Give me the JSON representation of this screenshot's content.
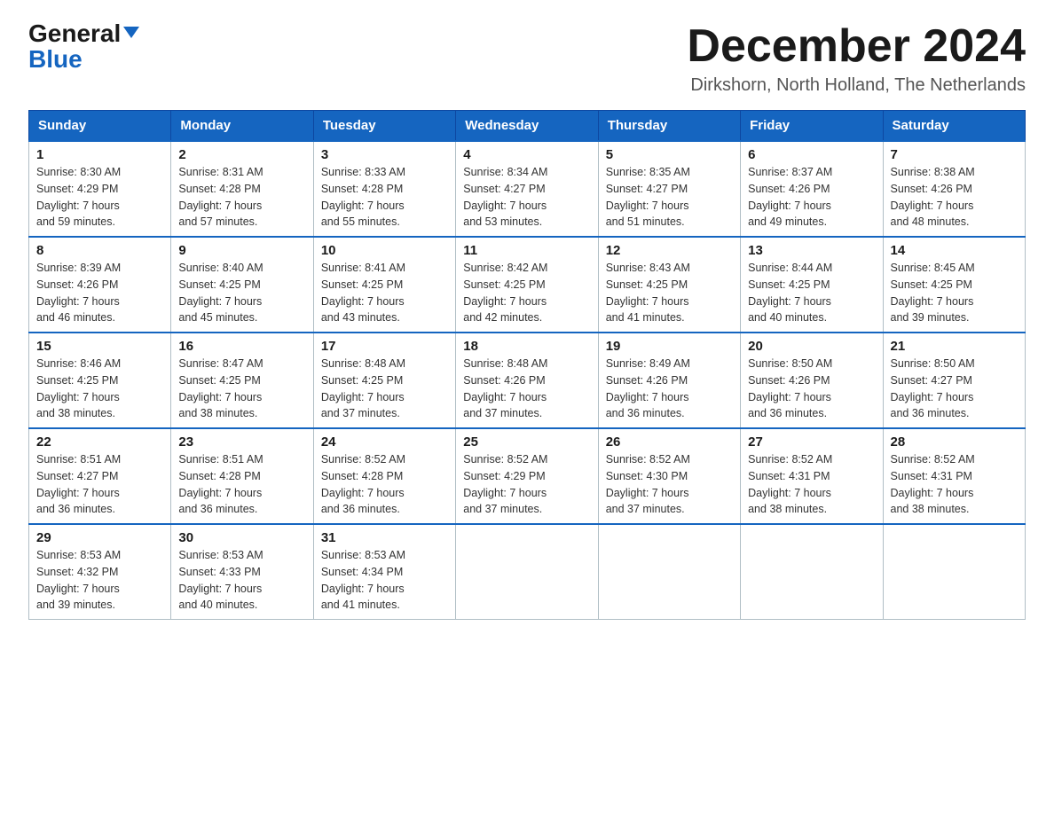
{
  "logo": {
    "general": "General",
    "triangle": "▲",
    "blue": "Blue"
  },
  "header": {
    "month_year": "December 2024",
    "location": "Dirkshorn, North Holland, The Netherlands"
  },
  "days_of_week": [
    "Sunday",
    "Monday",
    "Tuesday",
    "Wednesday",
    "Thursday",
    "Friday",
    "Saturday"
  ],
  "weeks": [
    [
      {
        "day": "1",
        "sunrise": "8:30 AM",
        "sunset": "4:29 PM",
        "daylight": "7 hours and 59 minutes."
      },
      {
        "day": "2",
        "sunrise": "8:31 AM",
        "sunset": "4:28 PM",
        "daylight": "7 hours and 57 minutes."
      },
      {
        "day": "3",
        "sunrise": "8:33 AM",
        "sunset": "4:28 PM",
        "daylight": "7 hours and 55 minutes."
      },
      {
        "day": "4",
        "sunrise": "8:34 AM",
        "sunset": "4:27 PM",
        "daylight": "7 hours and 53 minutes."
      },
      {
        "day": "5",
        "sunrise": "8:35 AM",
        "sunset": "4:27 PM",
        "daylight": "7 hours and 51 minutes."
      },
      {
        "day": "6",
        "sunrise": "8:37 AM",
        "sunset": "4:26 PM",
        "daylight": "7 hours and 49 minutes."
      },
      {
        "day": "7",
        "sunrise": "8:38 AM",
        "sunset": "4:26 PM",
        "daylight": "7 hours and 48 minutes."
      }
    ],
    [
      {
        "day": "8",
        "sunrise": "8:39 AM",
        "sunset": "4:26 PM",
        "daylight": "7 hours and 46 minutes."
      },
      {
        "day": "9",
        "sunrise": "8:40 AM",
        "sunset": "4:25 PM",
        "daylight": "7 hours and 45 minutes."
      },
      {
        "day": "10",
        "sunrise": "8:41 AM",
        "sunset": "4:25 PM",
        "daylight": "7 hours and 43 minutes."
      },
      {
        "day": "11",
        "sunrise": "8:42 AM",
        "sunset": "4:25 PM",
        "daylight": "7 hours and 42 minutes."
      },
      {
        "day": "12",
        "sunrise": "8:43 AM",
        "sunset": "4:25 PM",
        "daylight": "7 hours and 41 minutes."
      },
      {
        "day": "13",
        "sunrise": "8:44 AM",
        "sunset": "4:25 PM",
        "daylight": "7 hours and 40 minutes."
      },
      {
        "day": "14",
        "sunrise": "8:45 AM",
        "sunset": "4:25 PM",
        "daylight": "7 hours and 39 minutes."
      }
    ],
    [
      {
        "day": "15",
        "sunrise": "8:46 AM",
        "sunset": "4:25 PM",
        "daylight": "7 hours and 38 minutes."
      },
      {
        "day": "16",
        "sunrise": "8:47 AM",
        "sunset": "4:25 PM",
        "daylight": "7 hours and 38 minutes."
      },
      {
        "day": "17",
        "sunrise": "8:48 AM",
        "sunset": "4:25 PM",
        "daylight": "7 hours and 37 minutes."
      },
      {
        "day": "18",
        "sunrise": "8:48 AM",
        "sunset": "4:26 PM",
        "daylight": "7 hours and 37 minutes."
      },
      {
        "day": "19",
        "sunrise": "8:49 AM",
        "sunset": "4:26 PM",
        "daylight": "7 hours and 36 minutes."
      },
      {
        "day": "20",
        "sunrise": "8:50 AM",
        "sunset": "4:26 PM",
        "daylight": "7 hours and 36 minutes."
      },
      {
        "day": "21",
        "sunrise": "8:50 AM",
        "sunset": "4:27 PM",
        "daylight": "7 hours and 36 minutes."
      }
    ],
    [
      {
        "day": "22",
        "sunrise": "8:51 AM",
        "sunset": "4:27 PM",
        "daylight": "7 hours and 36 minutes."
      },
      {
        "day": "23",
        "sunrise": "8:51 AM",
        "sunset": "4:28 PM",
        "daylight": "7 hours and 36 minutes."
      },
      {
        "day": "24",
        "sunrise": "8:52 AM",
        "sunset": "4:28 PM",
        "daylight": "7 hours and 36 minutes."
      },
      {
        "day": "25",
        "sunrise": "8:52 AM",
        "sunset": "4:29 PM",
        "daylight": "7 hours and 37 minutes."
      },
      {
        "day": "26",
        "sunrise": "8:52 AM",
        "sunset": "4:30 PM",
        "daylight": "7 hours and 37 minutes."
      },
      {
        "day": "27",
        "sunrise": "8:52 AM",
        "sunset": "4:31 PM",
        "daylight": "7 hours and 38 minutes."
      },
      {
        "day": "28",
        "sunrise": "8:52 AM",
        "sunset": "4:31 PM",
        "daylight": "7 hours and 38 minutes."
      }
    ],
    [
      {
        "day": "29",
        "sunrise": "8:53 AM",
        "sunset": "4:32 PM",
        "daylight": "7 hours and 39 minutes."
      },
      {
        "day": "30",
        "sunrise": "8:53 AM",
        "sunset": "4:33 PM",
        "daylight": "7 hours and 40 minutes."
      },
      {
        "day": "31",
        "sunrise": "8:53 AM",
        "sunset": "4:34 PM",
        "daylight": "7 hours and 41 minutes."
      },
      null,
      null,
      null,
      null
    ]
  ],
  "labels": {
    "sunrise": "Sunrise:",
    "sunset": "Sunset:",
    "daylight": "Daylight:"
  }
}
